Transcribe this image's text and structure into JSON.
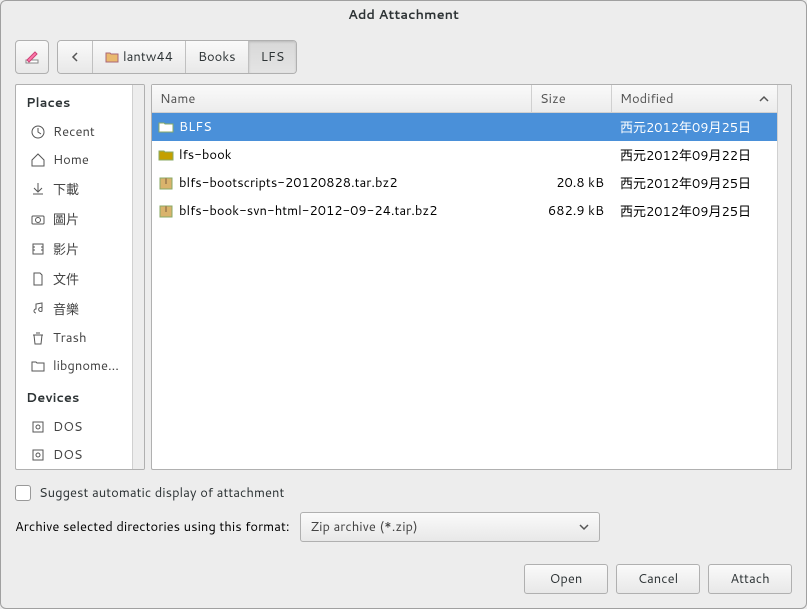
{
  "window": {
    "title": "Add Attachment"
  },
  "path": {
    "segments": [
      {
        "label": "lantw44",
        "icon": "home",
        "active": false
      },
      {
        "label": "Books",
        "active": false
      },
      {
        "label": "LFS",
        "active": true
      }
    ]
  },
  "sidebar": {
    "places_label": "Places",
    "devices_label": "Devices",
    "items": [
      {
        "label": "Recent",
        "icon": "clock"
      },
      {
        "label": "Home",
        "icon": "home"
      },
      {
        "label": "下載",
        "icon": "download"
      },
      {
        "label": "圖片",
        "icon": "camera"
      },
      {
        "label": "影片",
        "icon": "film"
      },
      {
        "label": "文件",
        "icon": "doc"
      },
      {
        "label": "音樂",
        "icon": "music"
      },
      {
        "label": "Trash",
        "icon": "trash"
      },
      {
        "label": "libgnome...",
        "icon": "folder"
      }
    ],
    "devices": [
      {
        "label": "DOS",
        "icon": "disk"
      },
      {
        "label": "DOS",
        "icon": "disk"
      }
    ]
  },
  "cols": {
    "name": "Name",
    "size": "Size",
    "modified": "Modified"
  },
  "files": [
    {
      "name": "BLFS",
      "size": "",
      "modified": "西元2012年09月25日",
      "type": "folder",
      "selected": true
    },
    {
      "name": "lfs-book",
      "size": "",
      "modified": "西元2012年09月22日",
      "type": "folder",
      "selected": false
    },
    {
      "name": "blfs-bootscripts-20120828.tar.bz2",
      "size": "20.8 kB",
      "modified": "西元2012年09月25日",
      "type": "pkg",
      "selected": false
    },
    {
      "name": "blfs-book-svn-html-2012-09-24.tar.bz2",
      "size": "682.9 kB",
      "modified": "西元2012年09月25日",
      "type": "pkg",
      "selected": false
    }
  ],
  "options": {
    "suggest": "Suggest automatic display of attachment",
    "format_label": "Archive selected directories using this format:",
    "format_value": "Zip archive (*.zip)"
  },
  "buttons": {
    "open": "Open",
    "cancel": "Cancel",
    "attach": "Attach"
  }
}
